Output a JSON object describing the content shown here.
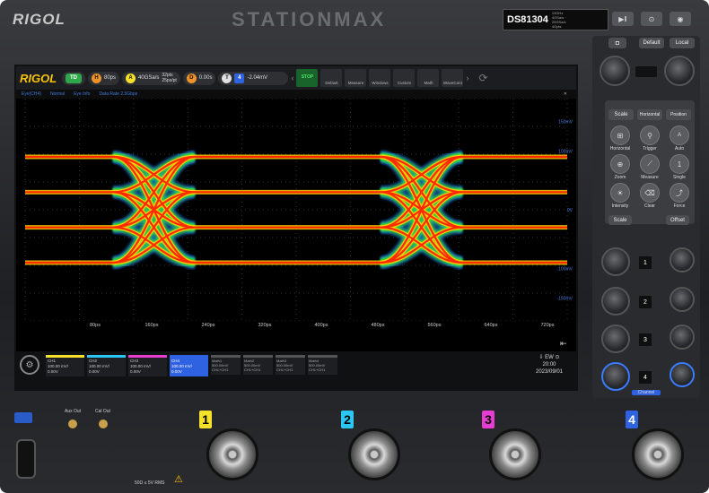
{
  "brand": "RIGOL",
  "series": "STATIONMAX",
  "model": "DS81304",
  "model_spec": "13GHz 4GSa/s · 20GSa/s 4Gpts",
  "top_buttons": [
    "▶‖",
    "⊙",
    "◉"
  ],
  "toolbar": {
    "logo": "RIGOL",
    "mode": "TD",
    "h_label": "H",
    "timebase": "80ps",
    "a_label": "A",
    "srate": "40GSa/s",
    "pts": "32pts",
    "pts_per_div": "25ps/pt",
    "d_label": "D",
    "delay": "0.00s",
    "t_label": "T",
    "t_channel": "4",
    "trigger_level": "-2.04mV",
    "run_label": "STOP",
    "run_sub": "RUN",
    "buttons": [
      "Default",
      "Measure",
      "Windows",
      "Custom",
      "Math",
      "WaveCont"
    ]
  },
  "tab": {
    "title": "Eye(CH4)",
    "items": [
      "Normal",
      "Eye Info",
      "Data Rate 2.5Gbps"
    ]
  },
  "chart_data": {
    "type": "heatmap",
    "title": "",
    "x_ticks": [
      "80ps",
      "160ps",
      "240ps",
      "320ps",
      "400ps",
      "480ps",
      "560ps",
      "640ps",
      "720ps"
    ],
    "y_ticks": [
      "150mV",
      "100mV",
      "0V",
      "-100mV",
      "-150mV"
    ],
    "levels_mV": [
      90,
      30,
      -30,
      -90
    ],
    "crossings_ps": [
      190,
      585
    ],
    "xlim_ps": [
      0,
      800
    ],
    "ylim_mV": [
      -180,
      180
    ],
    "colors": {
      "hot": "#ff2a00",
      "warm": "#ffd000",
      "mid": "#2fdc3a",
      "cool": "#1e6fd8"
    }
  },
  "channels": [
    {
      "name": "CH1",
      "scale": "100.00 mV/",
      "offset": "0.00V",
      "color": "#f5e02c"
    },
    {
      "name": "CH2",
      "scale": "100.00 mV/",
      "offset": "0.00V",
      "color": "#2cc6f5"
    },
    {
      "name": "CH3",
      "scale": "100.00 mV/",
      "offset": "0.00V",
      "color": "#e63cd0"
    },
    {
      "name": "CH4",
      "scale": "100.00 mV/",
      "offset": "0.00V",
      "color": "#2f62e0"
    }
  ],
  "maths": [
    {
      "name": "Math1",
      "scale": "500.00mV",
      "src": "CH1+CH1"
    },
    {
      "name": "Math2",
      "scale": "500.00mV",
      "src": "CH1+CH1"
    },
    {
      "name": "Math3",
      "scale": "500.00mV",
      "src": "CH1+CH1"
    },
    {
      "name": "Math4",
      "scale": "500.00mV",
      "src": "CH1+CH1"
    }
  ],
  "status": {
    "indicator": "⇩ EW ⊙",
    "time": "20:00",
    "date": "2023/09/01"
  },
  "panel": {
    "top": [
      "Default",
      "Local"
    ],
    "tabs": [
      "Scale",
      "Horizontal",
      "Position"
    ],
    "buttons": [
      "Horizontal",
      "Trigger",
      "Auto",
      "Zoom",
      "Measure",
      "Single",
      "Intensity",
      "Clear",
      "Force"
    ],
    "lower_tabs": [
      "Scale",
      "Offset"
    ],
    "channel_label": "Channel",
    "channel_nums": [
      "1",
      "2",
      "3",
      "4"
    ]
  },
  "bottom": {
    "aux_out": "Aux Out",
    "cal_out": "Cal Out",
    "input_spec": "50Ω ≤ 5V RMS",
    "channel_nums": [
      "1",
      "2",
      "3",
      "4"
    ],
    "channel_colors": [
      "#f5e02c",
      "#2cc6f5",
      "#e63cd0",
      "#2f62e0"
    ]
  }
}
